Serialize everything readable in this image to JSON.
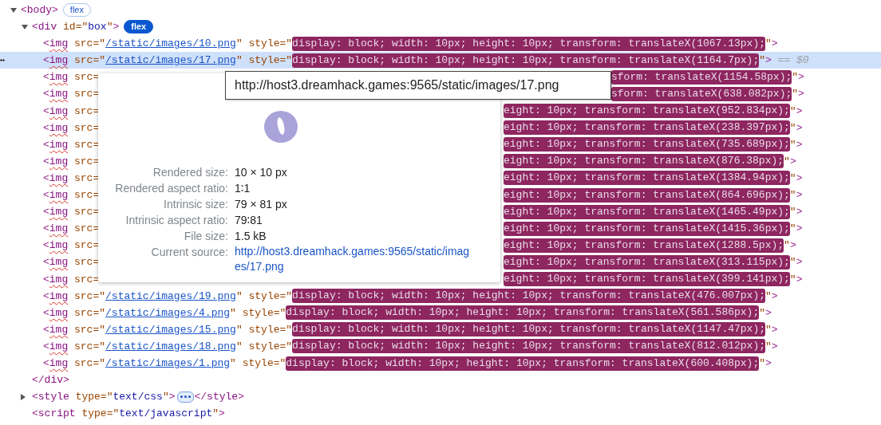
{
  "elements_tree": [
    {
      "selected": false,
      "expanded": true,
      "lint_warning": false,
      "tokens": [
        {
          "kind": "bracket",
          "text": "<"
        },
        {
          "kind": "tagname",
          "text": "body"
        },
        {
          "kind": "bracket",
          "text": ">"
        }
      ],
      "badge": {
        "text": "flex",
        "on": false
      },
      "children": [
        {
          "selected": false,
          "expanded": true,
          "lint_warning": false,
          "tokens": [
            {
              "kind": "bracket",
              "text": "<"
            },
            {
              "kind": "tagname",
              "text": "div"
            },
            {
              "kind": "attr",
              "text": " id"
            },
            {
              "kind": "punct",
              "text": "=\""
            },
            {
              "kind": "value",
              "text": "box"
            },
            {
              "kind": "punct",
              "text": "\""
            },
            {
              "kind": "bracket",
              "text": ">"
            }
          ],
          "badge": {
            "text": "flex",
            "on": true
          },
          "children": [
            {
              "selected": false,
              "lint_warning": true,
              "tokens": [
                {
                  "kind": "bracket",
                  "text": "<"
                },
                {
                  "kind": "tagname",
                  "text": "img"
                },
                {
                  "kind": "attr",
                  "text": " src"
                },
                {
                  "kind": "punct",
                  "text": "=\""
                },
                {
                  "kind": "link",
                  "text": "/static/images/10.png"
                },
                {
                  "kind": "punct",
                  "text": "\""
                },
                {
                  "kind": "attr",
                  "text": " style"
                },
                {
                  "kind": "punct",
                  "text": "=\""
                },
                {
                  "kind": "highlight",
                  "text": "display: block; width: 10px; height: 10px; transform: translateX(1067.13px);"
                },
                {
                  "kind": "punct",
                  "text": "\""
                },
                {
                  "kind": "bracket",
                  "text": ">"
                }
              ]
            },
            {
              "selected": true,
              "lint_warning": true,
              "console_ref": "== $0",
              "tokens": [
                {
                  "kind": "bracket",
                  "text": "<"
                },
                {
                  "kind": "tagname",
                  "text": "img"
                },
                {
                  "kind": "attr",
                  "text": " src"
                },
                {
                  "kind": "punct",
                  "text": "=\""
                },
                {
                  "kind": "link",
                  "text": "/static/images/17.png"
                },
                {
                  "kind": "punct",
                  "text": "\""
                },
                {
                  "kind": "attr",
                  "text": " style"
                },
                {
                  "kind": "punct",
                  "text": "=\""
                },
                {
                  "kind": "highlight",
                  "text": "display: block; width: 10px; height: 10px; transform: translateX(1164.7px);"
                },
                {
                  "kind": "punct",
                  "text": "\""
                },
                {
                  "kind": "bracket",
                  "text": ">"
                }
              ]
            },
            {
              "selected": false,
              "lint_warning": true,
              "under_tooltip": true,
              "tokens": [
                {
                  "kind": "bracket",
                  "text": "<"
                },
                {
                  "kind": "tagname",
                  "text": "img"
                },
                {
                  "kind": "attr",
                  "text": " src="
                }
              ],
              "tail": [
                {
                  "kind": "highlight",
                  "text": "sform: translateX(1154.58px);"
                },
                {
                  "kind": "punct",
                  "text": "\""
                },
                {
                  "kind": "bracket",
                  "text": ">"
                }
              ]
            },
            {
              "selected": false,
              "lint_warning": true,
              "under_tooltip": true,
              "tokens": [
                {
                  "kind": "bracket",
                  "text": "<"
                },
                {
                  "kind": "tagname",
                  "text": "img"
                },
                {
                  "kind": "attr",
                  "text": " src="
                }
              ],
              "tail": [
                {
                  "kind": "highlight",
                  "text": "sform: translateX(638.082px);"
                },
                {
                  "kind": "punct",
                  "text": "\""
                },
                {
                  "kind": "bracket",
                  "text": ">"
                }
              ]
            },
            {
              "selected": false,
              "lint_warning": true,
              "under_tooltip": false,
              "tokens": [
                {
                  "kind": "bracket",
                  "text": "<"
                },
                {
                  "kind": "tagname",
                  "text": "img"
                },
                {
                  "kind": "attr",
                  "text": " src="
                }
              ],
              "tail": [
                {
                  "kind": "highlight",
                  "text": "eight: 10px; transform: translateX(952.834px);"
                },
                {
                  "kind": "punct",
                  "text": "\""
                },
                {
                  "kind": "bracket",
                  "text": ">"
                }
              ]
            },
            {
              "selected": false,
              "lint_warning": true,
              "under_tooltip": false,
              "tokens": [
                {
                  "kind": "bracket",
                  "text": "<"
                },
                {
                  "kind": "tagname",
                  "text": "img"
                },
                {
                  "kind": "attr",
                  "text": " src="
                }
              ],
              "tail": [
                {
                  "kind": "highlight",
                  "text": "eight: 10px; transform: translateX(238.397px);"
                },
                {
                  "kind": "punct",
                  "text": "\""
                },
                {
                  "kind": "bracket",
                  "text": ">"
                }
              ]
            },
            {
              "selected": false,
              "lint_warning": true,
              "under_tooltip": false,
              "tokens": [
                {
                  "kind": "bracket",
                  "text": "<"
                },
                {
                  "kind": "tagname",
                  "text": "img"
                },
                {
                  "kind": "attr",
                  "text": " src="
                }
              ],
              "tail": [
                {
                  "kind": "highlight",
                  "text": "eight: 10px; transform: translateX(735.689px);"
                },
                {
                  "kind": "punct",
                  "text": "\""
                },
                {
                  "kind": "bracket",
                  "text": ">"
                }
              ]
            },
            {
              "selected": false,
              "lint_warning": true,
              "under_tooltip": false,
              "tokens": [
                {
                  "kind": "bracket",
                  "text": "<"
                },
                {
                  "kind": "tagname",
                  "text": "img"
                },
                {
                  "kind": "attr",
                  "text": " src="
                }
              ],
              "tail": [
                {
                  "kind": "highlight",
                  "text": "eight: 10px; transform: translateX(876.38px);"
                },
                {
                  "kind": "punct",
                  "text": "\""
                },
                {
                  "kind": "bracket",
                  "text": ">"
                }
              ]
            },
            {
              "selected": false,
              "lint_warning": true,
              "under_tooltip": false,
              "tokens": [
                {
                  "kind": "bracket",
                  "text": "<"
                },
                {
                  "kind": "tagname",
                  "text": "img"
                },
                {
                  "kind": "attr",
                  "text": " src="
                }
              ],
              "tail": [
                {
                  "kind": "highlight",
                  "text": "eight: 10px; transform: translateX(1384.94px);"
                },
                {
                  "kind": "punct",
                  "text": "\""
                },
                {
                  "kind": "bracket",
                  "text": ">"
                }
              ]
            },
            {
              "selected": false,
              "lint_warning": true,
              "under_tooltip": false,
              "tokens": [
                {
                  "kind": "bracket",
                  "text": "<"
                },
                {
                  "kind": "tagname",
                  "text": "img"
                },
                {
                  "kind": "attr",
                  "text": " src="
                }
              ],
              "tail": [
                {
                  "kind": "highlight",
                  "text": "eight: 10px; transform: translateX(864.696px);"
                },
                {
                  "kind": "punct",
                  "text": "\""
                },
                {
                  "kind": "bracket",
                  "text": ">"
                }
              ]
            },
            {
              "selected": false,
              "lint_warning": true,
              "under_tooltip": false,
              "tokens": [
                {
                  "kind": "bracket",
                  "text": "<"
                },
                {
                  "kind": "tagname",
                  "text": "img"
                },
                {
                  "kind": "attr",
                  "text": " src="
                }
              ],
              "tail": [
                {
                  "kind": "highlight",
                  "text": "eight: 10px; transform: translateX(1465.49px);"
                },
                {
                  "kind": "punct",
                  "text": "\""
                },
                {
                  "kind": "bracket",
                  "text": ">"
                }
              ]
            },
            {
              "selected": false,
              "lint_warning": true,
              "under_tooltip": false,
              "tokens": [
                {
                  "kind": "bracket",
                  "text": "<"
                },
                {
                  "kind": "tagname",
                  "text": "img"
                },
                {
                  "kind": "attr",
                  "text": " src="
                }
              ],
              "tail": [
                {
                  "kind": "highlight",
                  "text": "eight: 10px; transform: translateX(1415.36px);"
                },
                {
                  "kind": "punct",
                  "text": "\""
                },
                {
                  "kind": "bracket",
                  "text": ">"
                }
              ]
            },
            {
              "selected": false,
              "lint_warning": true,
              "under_tooltip": false,
              "tokens": [
                {
                  "kind": "bracket",
                  "text": "<"
                },
                {
                  "kind": "tagname",
                  "text": "img"
                },
                {
                  "kind": "attr",
                  "text": " src="
                }
              ],
              "tail": [
                {
                  "kind": "highlight",
                  "text": "eight: 10px; transform: translateX(1288.5px);"
                },
                {
                  "kind": "punct",
                  "text": "\""
                },
                {
                  "kind": "bracket",
                  "text": ">"
                }
              ]
            },
            {
              "selected": false,
              "lint_warning": true,
              "under_tooltip": false,
              "tokens": [
                {
                  "kind": "bracket",
                  "text": "<"
                },
                {
                  "kind": "tagname",
                  "text": "img"
                },
                {
                  "kind": "attr",
                  "text": " src="
                }
              ],
              "tail": [
                {
                  "kind": "highlight",
                  "text": "eight: 10px; transform: translateX(313.115px);"
                },
                {
                  "kind": "punct",
                  "text": "\""
                },
                {
                  "kind": "bracket",
                  "text": ">"
                }
              ]
            },
            {
              "selected": false,
              "lint_warning": true,
              "under_tooltip": false,
              "tokens": [
                {
                  "kind": "bracket",
                  "text": "<"
                },
                {
                  "kind": "tagname",
                  "text": "img"
                },
                {
                  "kind": "attr",
                  "text": " src="
                }
              ],
              "tail": [
                {
                  "kind": "highlight",
                  "text": "eight: 10px; transform: translateX(399.141px);"
                },
                {
                  "kind": "punct",
                  "text": "\""
                },
                {
                  "kind": "bracket",
                  "text": ">"
                }
              ]
            },
            {
              "selected": false,
              "lint_warning": true,
              "tokens": [
                {
                  "kind": "bracket",
                  "text": "<"
                },
                {
                  "kind": "tagname",
                  "text": "img"
                },
                {
                  "kind": "attr",
                  "text": " src"
                },
                {
                  "kind": "punct",
                  "text": "=\""
                },
                {
                  "kind": "link",
                  "text": "/static/images/19.png"
                },
                {
                  "kind": "punct",
                  "text": "\""
                },
                {
                  "kind": "attr",
                  "text": " style"
                },
                {
                  "kind": "punct",
                  "text": "=\""
                },
                {
                  "kind": "highlight",
                  "text": "display: block; width: 10px; height: 10px; transform: translateX(476.007px);"
                },
                {
                  "kind": "punct",
                  "text": "\""
                },
                {
                  "kind": "bracket",
                  "text": ">"
                }
              ]
            },
            {
              "selected": false,
              "lint_warning": true,
              "tokens": [
                {
                  "kind": "bracket",
                  "text": "<"
                },
                {
                  "kind": "tagname",
                  "text": "img"
                },
                {
                  "kind": "attr",
                  "text": " src"
                },
                {
                  "kind": "punct",
                  "text": "=\""
                },
                {
                  "kind": "link",
                  "text": "/static/images/4.png"
                },
                {
                  "kind": "punct",
                  "text": "\""
                },
                {
                  "kind": "attr",
                  "text": " style"
                },
                {
                  "kind": "punct",
                  "text": "=\""
                },
                {
                  "kind": "highlight",
                  "text": "display: block; width: 10px; height: 10px; transform: translateX(561.586px);"
                },
                {
                  "kind": "punct",
                  "text": "\""
                },
                {
                  "kind": "bracket",
                  "text": ">"
                }
              ]
            },
            {
              "selected": false,
              "lint_warning": true,
              "tokens": [
                {
                  "kind": "bracket",
                  "text": "<"
                },
                {
                  "kind": "tagname",
                  "text": "img"
                },
                {
                  "kind": "attr",
                  "text": " src"
                },
                {
                  "kind": "punct",
                  "text": "=\""
                },
                {
                  "kind": "link",
                  "text": "/static/images/15.png"
                },
                {
                  "kind": "punct",
                  "text": "\""
                },
                {
                  "kind": "attr",
                  "text": " style"
                },
                {
                  "kind": "punct",
                  "text": "=\""
                },
                {
                  "kind": "highlight",
                  "text": "display: block; width: 10px; height: 10px; transform: translateX(1147.47px);"
                },
                {
                  "kind": "punct",
                  "text": "\""
                },
                {
                  "kind": "bracket",
                  "text": ">"
                }
              ]
            },
            {
              "selected": false,
              "lint_warning": true,
              "tokens": [
                {
                  "kind": "bracket",
                  "text": "<"
                },
                {
                  "kind": "tagname",
                  "text": "img"
                },
                {
                  "kind": "attr",
                  "text": " src"
                },
                {
                  "kind": "punct",
                  "text": "=\""
                },
                {
                  "kind": "link",
                  "text": "/static/images/18.png"
                },
                {
                  "kind": "punct",
                  "text": "\""
                },
                {
                  "kind": "attr",
                  "text": " style"
                },
                {
                  "kind": "punct",
                  "text": "=\""
                },
                {
                  "kind": "highlight",
                  "text": "display: block; width: 10px; height: 10px; transform: translateX(812.012px);"
                },
                {
                  "kind": "punct",
                  "text": "\""
                },
                {
                  "kind": "bracket",
                  "text": ">"
                }
              ]
            },
            {
              "selected": false,
              "lint_warning": true,
              "tokens": [
                {
                  "kind": "bracket",
                  "text": "<"
                },
                {
                  "kind": "tagname",
                  "text": "img"
                },
                {
                  "kind": "attr",
                  "text": " src"
                },
                {
                  "kind": "punct",
                  "text": "=\""
                },
                {
                  "kind": "link",
                  "text": "/static/images/1.png"
                },
                {
                  "kind": "punct",
                  "text": "\""
                },
                {
                  "kind": "attr",
                  "text": " style"
                },
                {
                  "kind": "punct",
                  "text": "=\""
                },
                {
                  "kind": "highlight",
                  "text": "display: block; width: 10px; height: 10px; transform: translateX(600.408px);"
                },
                {
                  "kind": "punct",
                  "text": "\""
                },
                {
                  "kind": "bracket",
                  "text": ">"
                }
              ]
            }
          ],
          "closing": [
            {
              "kind": "bracket",
              "text": "</"
            },
            {
              "kind": "tagname",
              "text": "div"
            },
            {
              "kind": "bracket",
              "text": ">"
            }
          ]
        },
        {
          "selected": false,
          "expanded": false,
          "lint_warning": false,
          "tokens": [
            {
              "kind": "bracket",
              "text": "<"
            },
            {
              "kind": "tagname",
              "text": "style"
            },
            {
              "kind": "attr",
              "text": " type"
            },
            {
              "kind": "punct",
              "text": "=\""
            },
            {
              "kind": "value",
              "text": "text/css"
            },
            {
              "kind": "punct",
              "text": "\""
            },
            {
              "kind": "bracket",
              "text": ">"
            }
          ],
          "after": [
            {
              "kind": "bracket",
              "text": "</"
            },
            {
              "kind": "tagname",
              "text": "style"
            },
            {
              "kind": "bracket",
              "text": ">"
            }
          ]
        },
        {
          "selected": false,
          "lint_warning": false,
          "tokens": [
            {
              "kind": "bracket",
              "text": "<"
            },
            {
              "kind": "tagname",
              "text": "script"
            },
            {
              "kind": "attr",
              "text": " type"
            },
            {
              "kind": "punct",
              "text": "=\""
            },
            {
              "kind": "value",
              "text": "text/javascript"
            },
            {
              "kind": "punct",
              "text": "\""
            },
            {
              "kind": "bracket",
              "text": ">"
            }
          ]
        }
      ]
    }
  ],
  "image_popover": {
    "details": [
      {
        "label": "Rendered size:",
        "value": "10 × 10 px"
      },
      {
        "label": "Rendered aspect ratio:",
        "value": "1∶1"
      },
      {
        "label": "Intrinsic size:",
        "value": "79 × 81 px"
      },
      {
        "label": "Intrinsic aspect ratio:",
        "value": "79∶81"
      },
      {
        "label": "File size:",
        "value": "1.5 kB"
      },
      {
        "label": "Current source:",
        "value": "http://host3.dreamhack.games:9565/static/images/17.png",
        "kind": "link"
      }
    ]
  },
  "url_tooltip": {
    "text": "http://host3.dreamhack.games:9565/static/images/17.png"
  }
}
